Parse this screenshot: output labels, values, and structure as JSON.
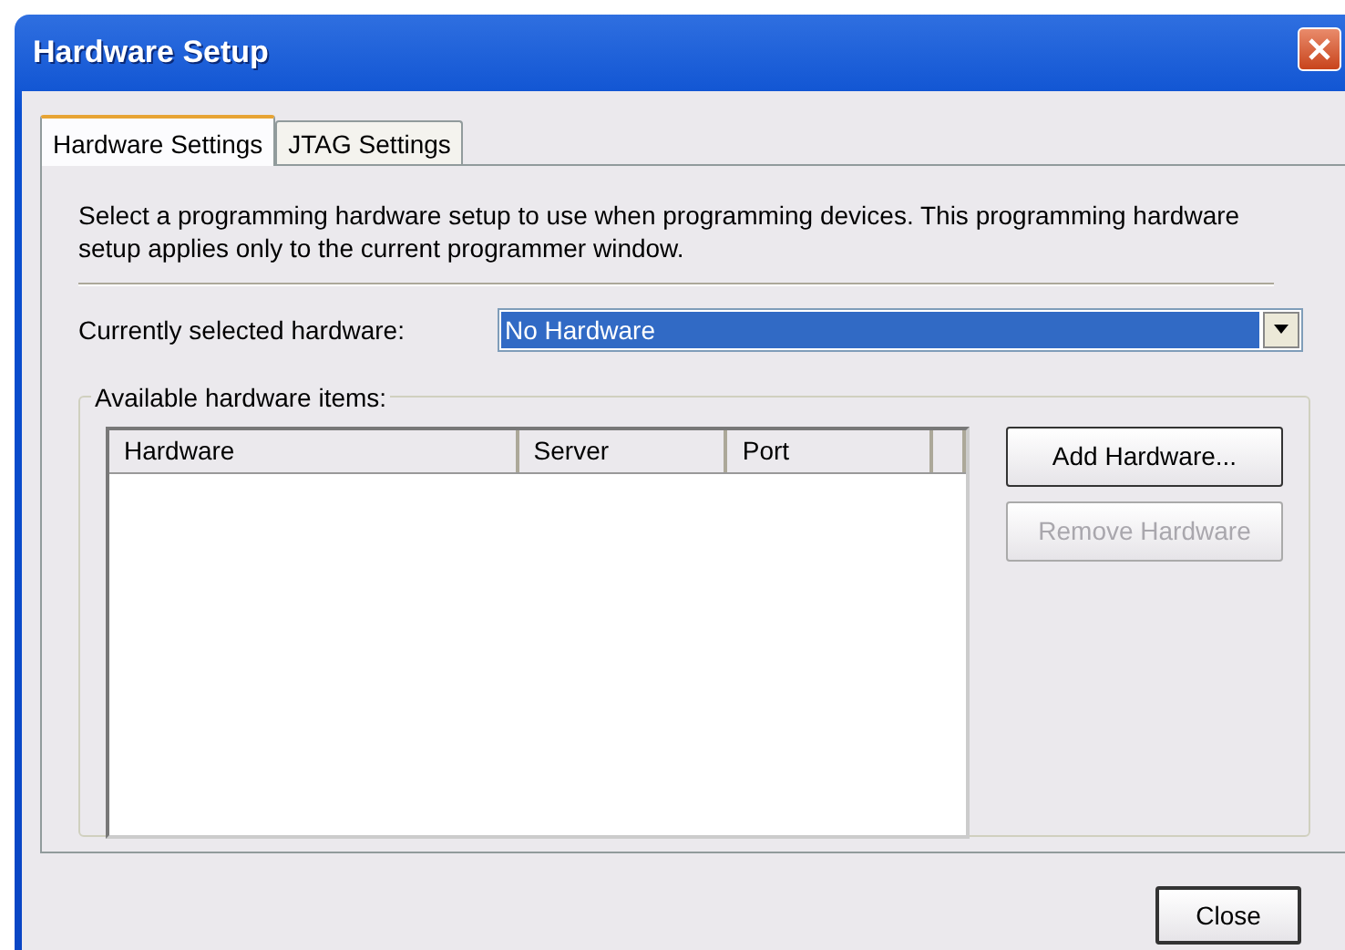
{
  "window": {
    "title": "Hardware Setup"
  },
  "tabs": [
    {
      "label": "Hardware Settings",
      "selected": true
    },
    {
      "label": "JTAG Settings",
      "selected": false
    }
  ],
  "description": "Select a programming hardware setup to use when programming devices. This programming hardware setup applies only to the current programmer window.",
  "hardware_select": {
    "label": "Currently selected hardware:",
    "value": "No Hardware"
  },
  "available_hardware": {
    "label": "Available hardware items:",
    "columns": [
      "Hardware",
      "Server",
      "Port"
    ],
    "buttons": [
      {
        "label": "Add Hardware...",
        "disabled": false
      },
      {
        "label": "Remove Hardware",
        "disabled": true
      }
    ]
  },
  "footer_buttons": [
    "Close"
  ]
}
